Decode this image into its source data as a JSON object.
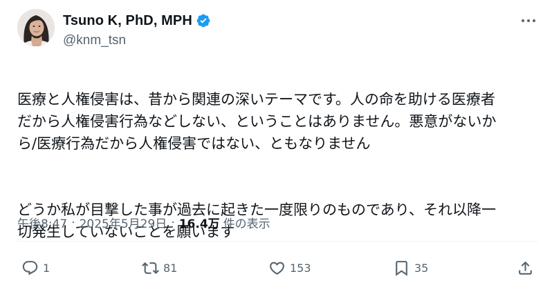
{
  "author": {
    "display_name": "Tsuno K, PhD, MPH",
    "handle": "@knm_tsn",
    "avatar": "avatar-photo",
    "verified_icon": "verified-badge-icon",
    "verified_color": "#1d9bf0"
  },
  "post": {
    "paragraphs": [
      "医療と人権侵害は、昔から関連の深いテーマです。人の命を助ける医療者\nだから人権侵害行為などしない、ということはありません。悪意がないか\nら/医療行為だから人権侵害ではない、ともなりません",
      "どうか私が目撃した事が過去に起きた一度限りのものであり、それ以降一\n切発生していないことを願います"
    ]
  },
  "meta": {
    "time": "午後8:47",
    "separator": "·",
    "date": "2025年5月29日",
    "views_count": "16.4万",
    "views_label": "件の表示"
  },
  "actions": {
    "reply": {
      "icon": "reply-icon",
      "count": "1"
    },
    "retweet": {
      "icon": "retweet-icon",
      "count": "81"
    },
    "like": {
      "icon": "heart-icon",
      "count": "153"
    },
    "bookmark": {
      "icon": "bookmark-icon",
      "count": "35"
    },
    "share": {
      "icon": "share-icon"
    }
  },
  "colors": {
    "text_primary": "#0f1419",
    "text_secondary": "#536471",
    "divider": "#eff3f4"
  }
}
